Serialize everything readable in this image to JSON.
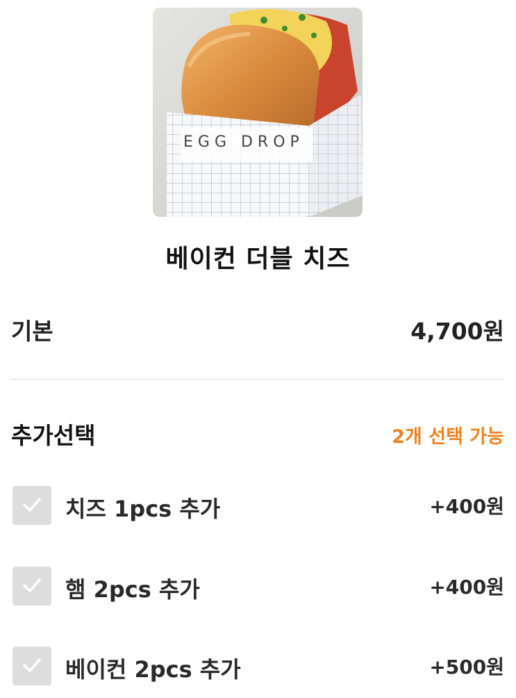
{
  "product": {
    "image_alt": "EGG DROP sandwich",
    "box_text": "EGG DROP",
    "title": "베이컨 더블 치즈"
  },
  "base": {
    "label": "기본",
    "price": "4,700원"
  },
  "options": {
    "title": "추가선택",
    "hint": "2개 선택 가능",
    "hint_color": "#f0831e",
    "items": [
      {
        "label": "치즈 1pcs 추가",
        "price": "+400원",
        "checked": false
      },
      {
        "label": "햄 2pcs 추가",
        "price": "+400원",
        "checked": false
      },
      {
        "label": "베이컨 2pcs 추가",
        "price": "+500원",
        "checked": false
      }
    ]
  }
}
